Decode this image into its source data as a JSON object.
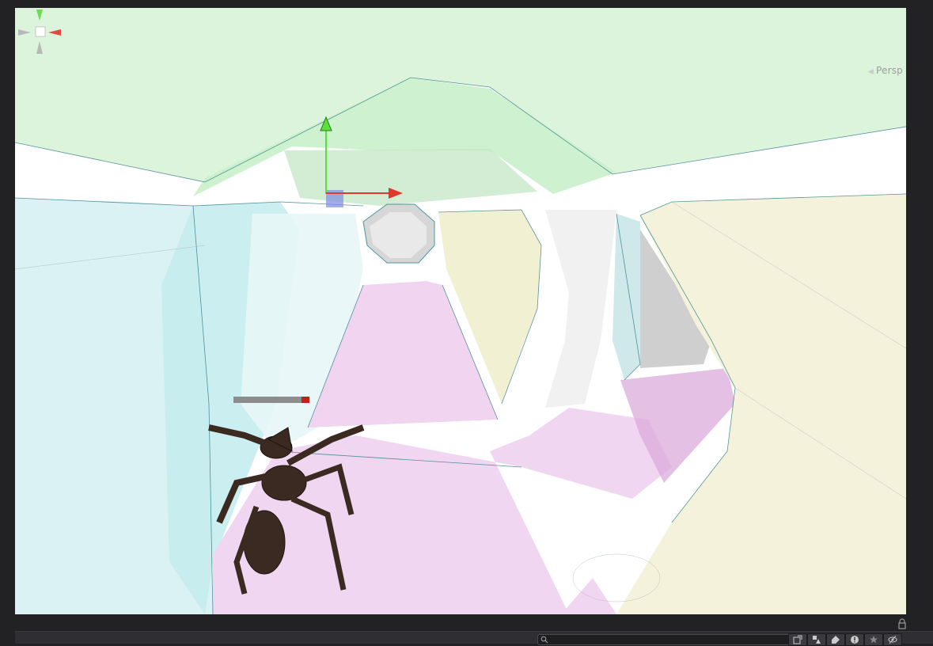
{
  "app": {
    "window": "Scene",
    "view_mode": "Persp"
  },
  "toolbar": {
    "search": {
      "value": "",
      "placeholder": ""
    },
    "buttons": [
      {
        "icon": "open-window-icon"
      },
      {
        "icon": "filter-by-type-icon"
      },
      {
        "icon": "label-tag-icon"
      },
      {
        "icon": "warning-icon"
      },
      {
        "icon": "favorites-star-icon"
      },
      {
        "icon": "visibility-eye-icon"
      }
    ]
  },
  "colors": {
    "ceiling": "#d8f2d8",
    "left_wall": "#d8f0f2",
    "right_wall": "#f4f2d8",
    "floor": "#f0d8f0",
    "background": "#222124",
    "axis_x": "#e03a2e",
    "axis_y": "#5be03a",
    "axis_z": "#6f7cd8"
  }
}
